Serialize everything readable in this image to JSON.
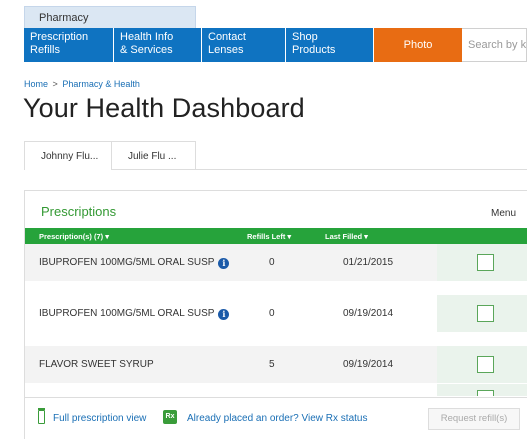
{
  "top_tab": {
    "label": "Pharmacy"
  },
  "nav": {
    "items": [
      {
        "line1": "Prescription",
        "line2": "Refills"
      },
      {
        "line1": "Health Info",
        "line2": "& Services"
      },
      {
        "line1": "Contact",
        "line2": "Lenses"
      },
      {
        "line1": "Shop",
        "line2": "Products"
      }
    ],
    "photo_label": "Photo",
    "search_placeholder": "Search by keyw",
    "colors": {
      "blue": "#0f73c1",
      "orange": "#e86c13"
    }
  },
  "breadcrumb": {
    "home": "Home",
    "separator": ">",
    "current": "Pharmacy & Health"
  },
  "page_title": "Your Health Dashboard",
  "person_tabs": [
    {
      "label": "Johnny Flu...",
      "active": true
    },
    {
      "label": "Julie Flu ...",
      "active": false
    }
  ],
  "prescriptions": {
    "title": "Prescriptions",
    "menu_label": "Menu",
    "columns": {
      "rx": "Prescription(s) (7) ▾",
      "refills": "Refills Left ▾",
      "filled": "Last Filled ▾"
    },
    "rows": [
      {
        "name": "IBUPROFEN 100MG/5ML ORAL SUSP",
        "info_icon": "info-icon",
        "refills": "0",
        "last_filled": "01/21/2015"
      },
      {
        "name": "IBUPROFEN 100MG/5ML ORAL SUSP",
        "info_icon": "info-icon",
        "refills": "0",
        "last_filled": "09/19/2014"
      },
      {
        "name": "FLAVOR SWEET SYRUP",
        "refills": "5",
        "last_filled": "09/19/2014"
      }
    ],
    "footer": {
      "full_view": "Full prescription view",
      "already_placed": "Already placed an order? View Rx status",
      "refill_button": "Request refill(s)"
    },
    "accent_color": "#26a33b"
  }
}
